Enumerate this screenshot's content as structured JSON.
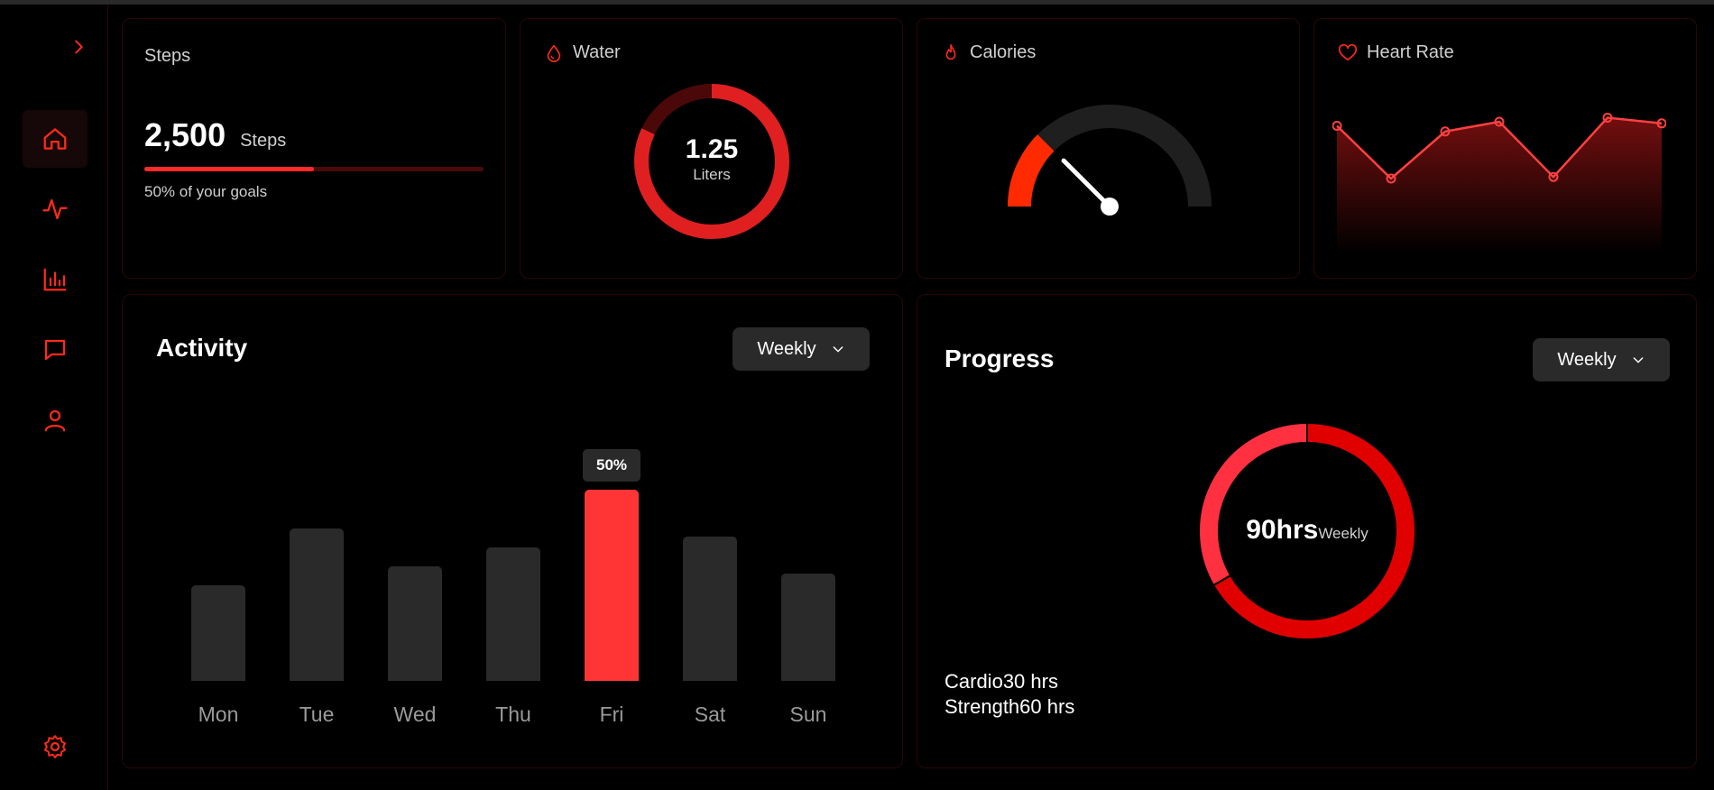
{
  "sidebar": {
    "nav": [
      {
        "icon": "home-icon",
        "active": true
      },
      {
        "icon": "activity-icon",
        "active": false
      },
      {
        "icon": "bar-chart-icon",
        "active": false
      },
      {
        "icon": "message-icon",
        "active": false
      },
      {
        "icon": "user-icon",
        "active": false
      }
    ],
    "settings_icon": "gear-icon",
    "toggle_icon": "chevron-right-icon"
  },
  "steps": {
    "title": "Steps",
    "value": "2,500",
    "unit": "Steps",
    "progress": 0.5,
    "goal_text": "50% of your goals"
  },
  "water": {
    "title": "Water",
    "value": "1.25",
    "unit": "Liters",
    "fill": 0.82
  },
  "calories": {
    "title": "Calories",
    "level": 0.25
  },
  "heart_rate": {
    "title": "Heart Rate",
    "points": [
      0.85,
      0.2,
      0.78,
      0.9,
      0.22,
      0.95,
      0.88
    ]
  },
  "activity": {
    "title": "Activity",
    "dropdown": "Weekly",
    "chart_data": {
      "type": "bar",
      "categories": [
        "Mon",
        "Tue",
        "Wed",
        "Thu",
        "Fri",
        "Sat",
        "Sun"
      ],
      "values": [
        88,
        140,
        105,
        122,
        175,
        132,
        98
      ],
      "highlight_index": 4,
      "highlight_label": "50%"
    }
  },
  "progress": {
    "title": "Progress",
    "dropdown": "Weekly",
    "center_value": "90hrs",
    "center_label": "Weekly",
    "chart_data": {
      "type": "pie",
      "categories": [
        "Cardio",
        "Strength"
      ],
      "values": [
        30,
        60
      ]
    },
    "legend": [
      {
        "name": "Cardio",
        "value": "30 hrs"
      },
      {
        "name": "Strength",
        "value": "60 hrs"
      }
    ]
  },
  "colors": {
    "accent": "#ff3535",
    "accent_dark": "#e00000",
    "accent_light": "#ff3040",
    "bar_gray": "#2a2a2a",
    "card_border": "#2a0606"
  }
}
